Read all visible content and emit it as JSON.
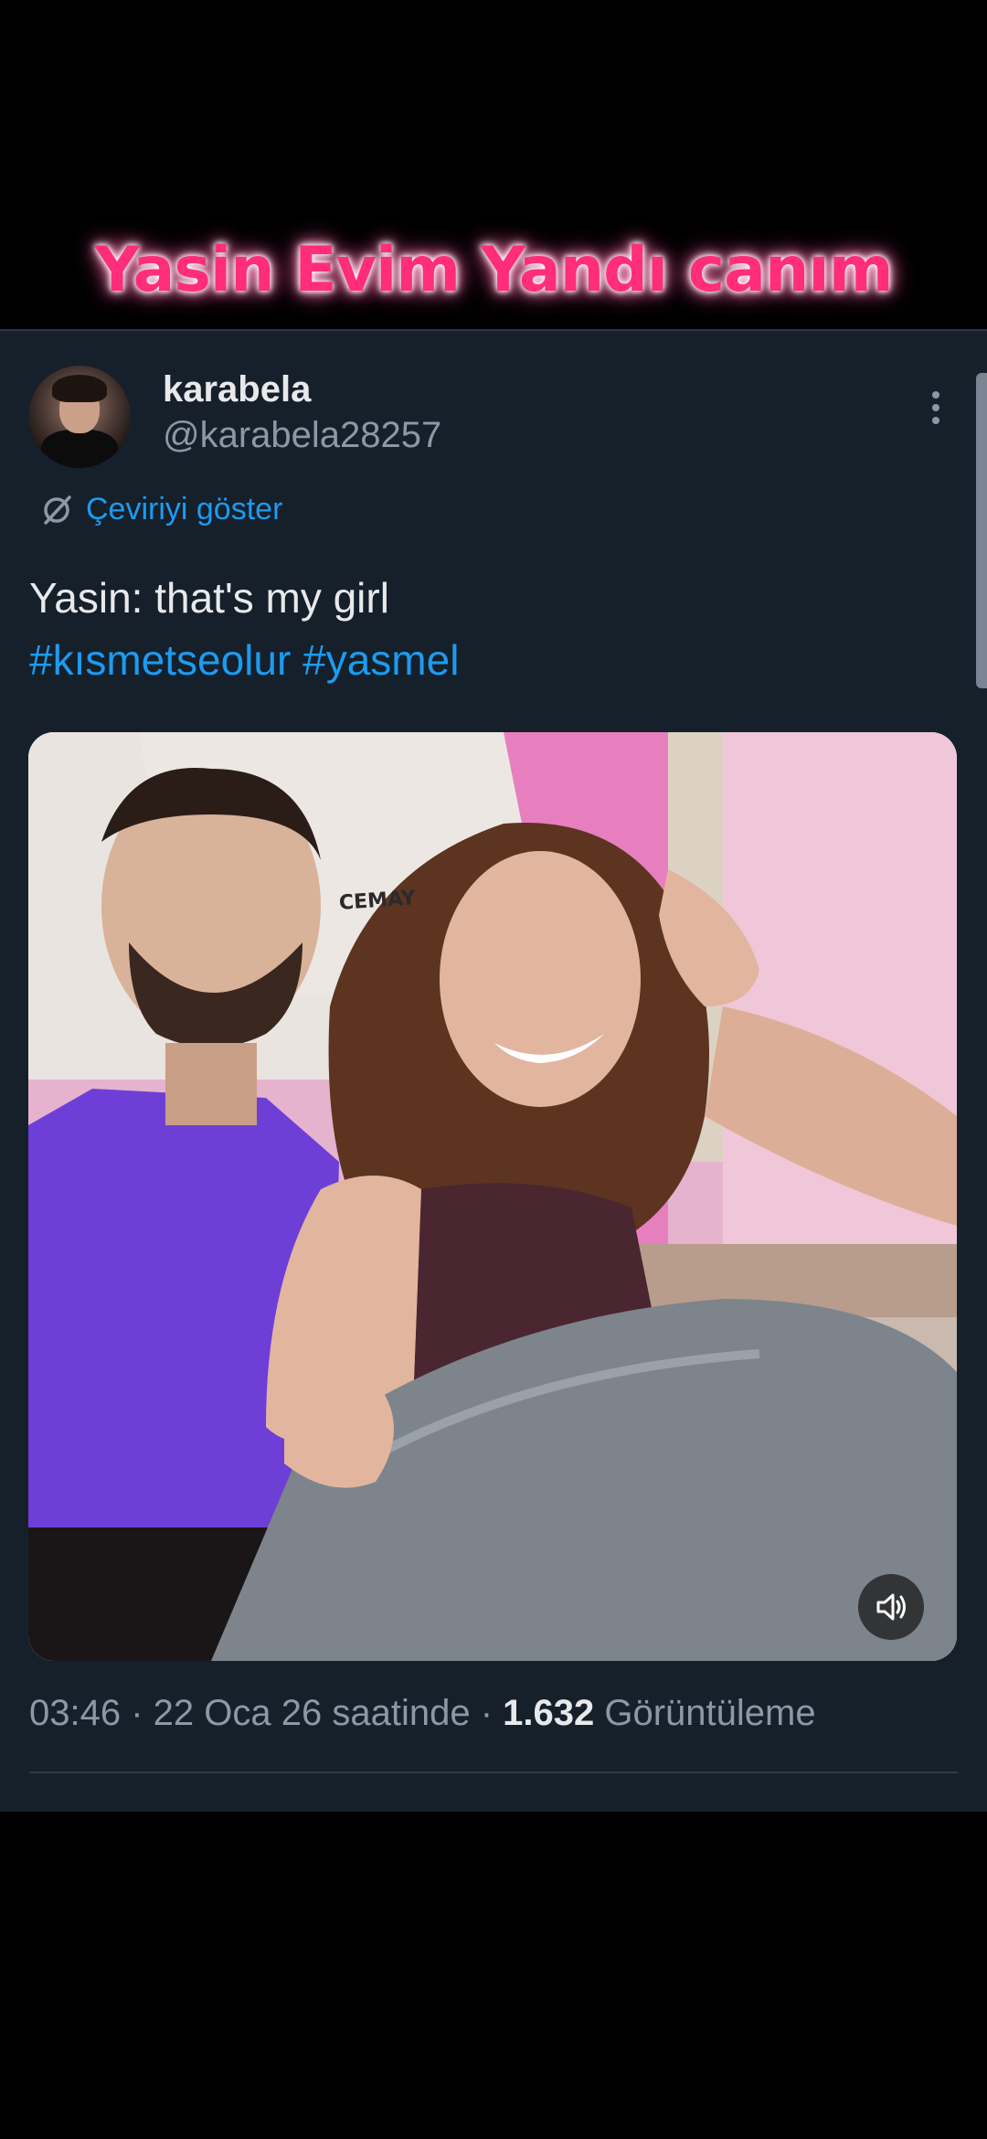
{
  "overlay": {
    "caption": "Yasin Evim Yandı canım",
    "caption_color": "#ff2d7a"
  },
  "tweet": {
    "author": {
      "display_name": "karabela",
      "handle": "@karabela28257",
      "avatar_icon": "profile-photo"
    },
    "more_icon": "vertical-ellipsis-icon",
    "translate": {
      "icon": "translate-icon",
      "label": "Çeviriyi göster"
    },
    "text": {
      "line1": "Yasin: that's my girl",
      "hashtag1": "#kısmetseolur",
      "hashtag2": "#yasmel"
    },
    "media": {
      "type": "video",
      "shirt_text": "CEMAY",
      "mute_icon": "volume-icon"
    },
    "meta": {
      "time": "03:46",
      "separator": " · ",
      "date": "22 Oca 26 saatinde",
      "views_count": "1.632",
      "views_label": "Görüntüleme"
    }
  },
  "colors": {
    "card_background": "#15202b",
    "primary_text": "#e7e9ea",
    "secondary_text": "#8b98a5",
    "accent_blue": "#1d9bf0"
  }
}
